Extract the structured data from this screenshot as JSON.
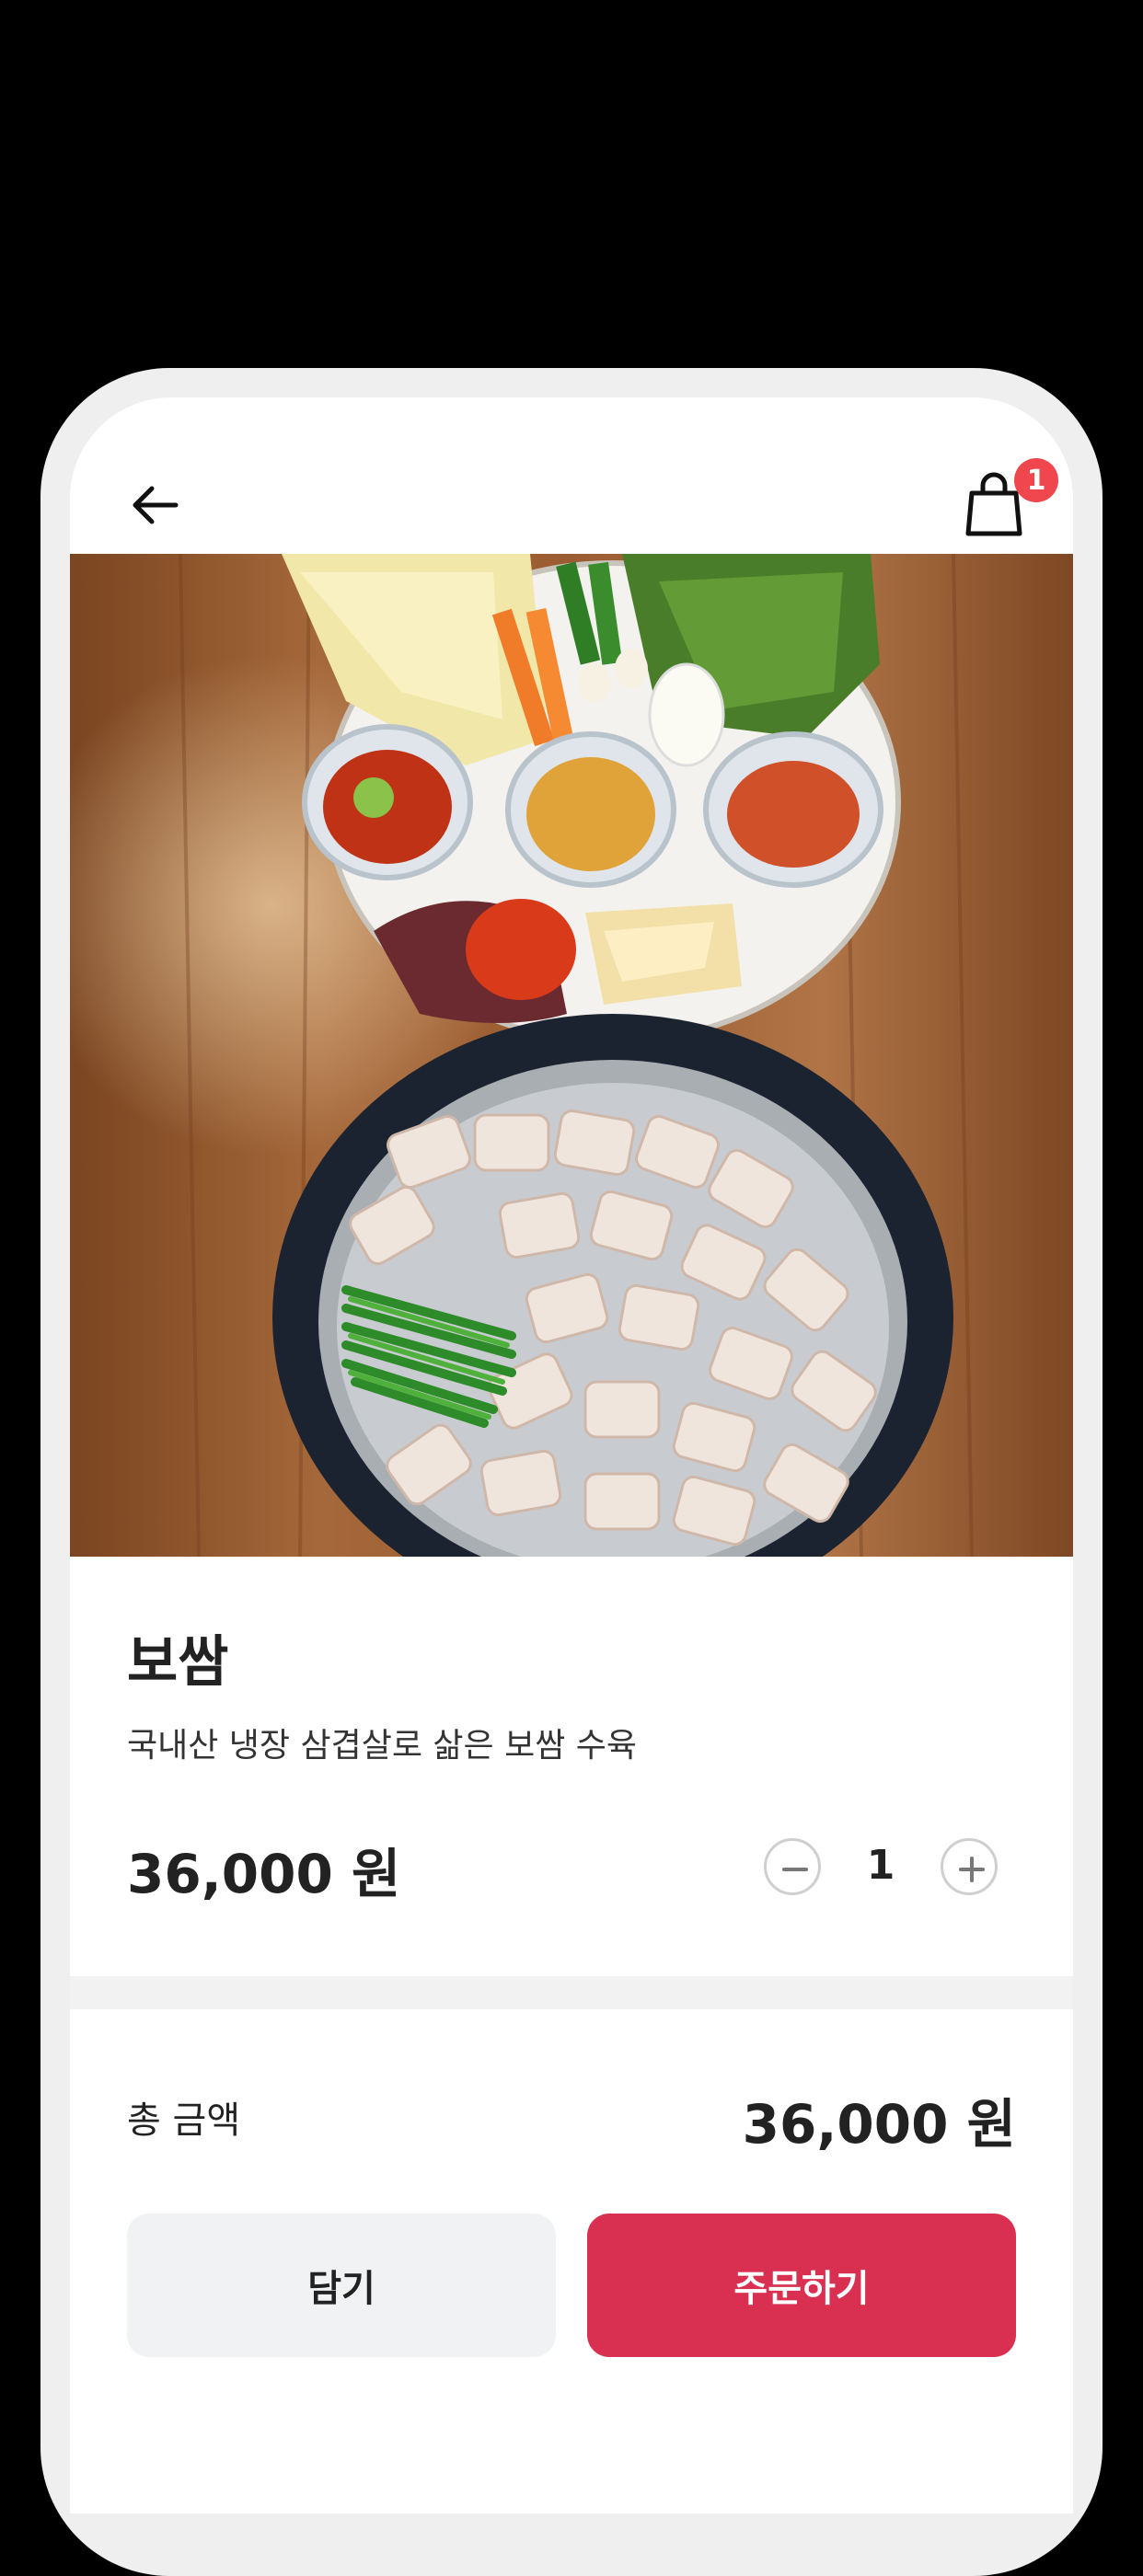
{
  "nav": {
    "back_icon": "arrow-left-icon",
    "cart_icon": "shopping-bag-icon",
    "cart_count": "1"
  },
  "product": {
    "image_desc_icon": "food-photo",
    "name": "보쌈",
    "description": "국내산 냉장 삼겹살로 삶은 보쌈 수육",
    "price": "36,000 원",
    "quantity": "1",
    "decrement_icon": "minus-icon",
    "increment_icon": "plus-icon"
  },
  "summary": {
    "total_label": "총 금액",
    "total_value": "36,000 원"
  },
  "actions": {
    "add_to_cart_label": "담기",
    "order_label": "주문하기"
  },
  "colors": {
    "accent": "#d93052",
    "badge": "#f0474f"
  }
}
